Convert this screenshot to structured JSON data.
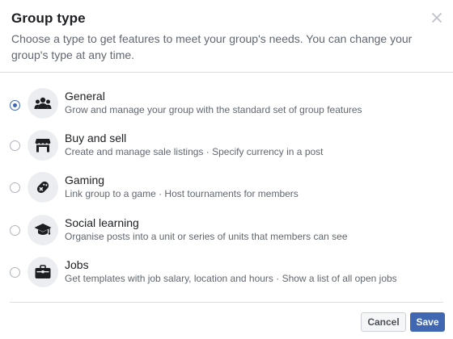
{
  "dialog": {
    "title": "Group type",
    "subtitle": "Choose a type to get features to meet your group's needs. You can change your group's type at any time."
  },
  "options": [
    {
      "label": "General",
      "description": "Grow and manage your group with the standard set of group features",
      "icon": "people-icon",
      "selected": true
    },
    {
      "label": "Buy and sell",
      "description": "Create and manage sale listings · Specify currency in a post",
      "icon": "shop-icon",
      "selected": false
    },
    {
      "label": "Gaming",
      "description": "Link group to a game · Host tournaments for members",
      "icon": "gamepad-icon",
      "selected": false
    },
    {
      "label": "Social learning",
      "description": "Organise posts into a unit or series of units that members can see",
      "icon": "graduation-cap-icon",
      "selected": false
    },
    {
      "label": "Jobs",
      "description": "Get templates with job salary, location and hours · Show a list of all open jobs",
      "icon": "briefcase-icon",
      "selected": false
    }
  ],
  "buttons": {
    "cancel_label": "Cancel",
    "save_label": "Save"
  },
  "colors": {
    "accent": "#4267b2",
    "icon_bg": "#ebedf0",
    "text_secondary": "#606770"
  }
}
